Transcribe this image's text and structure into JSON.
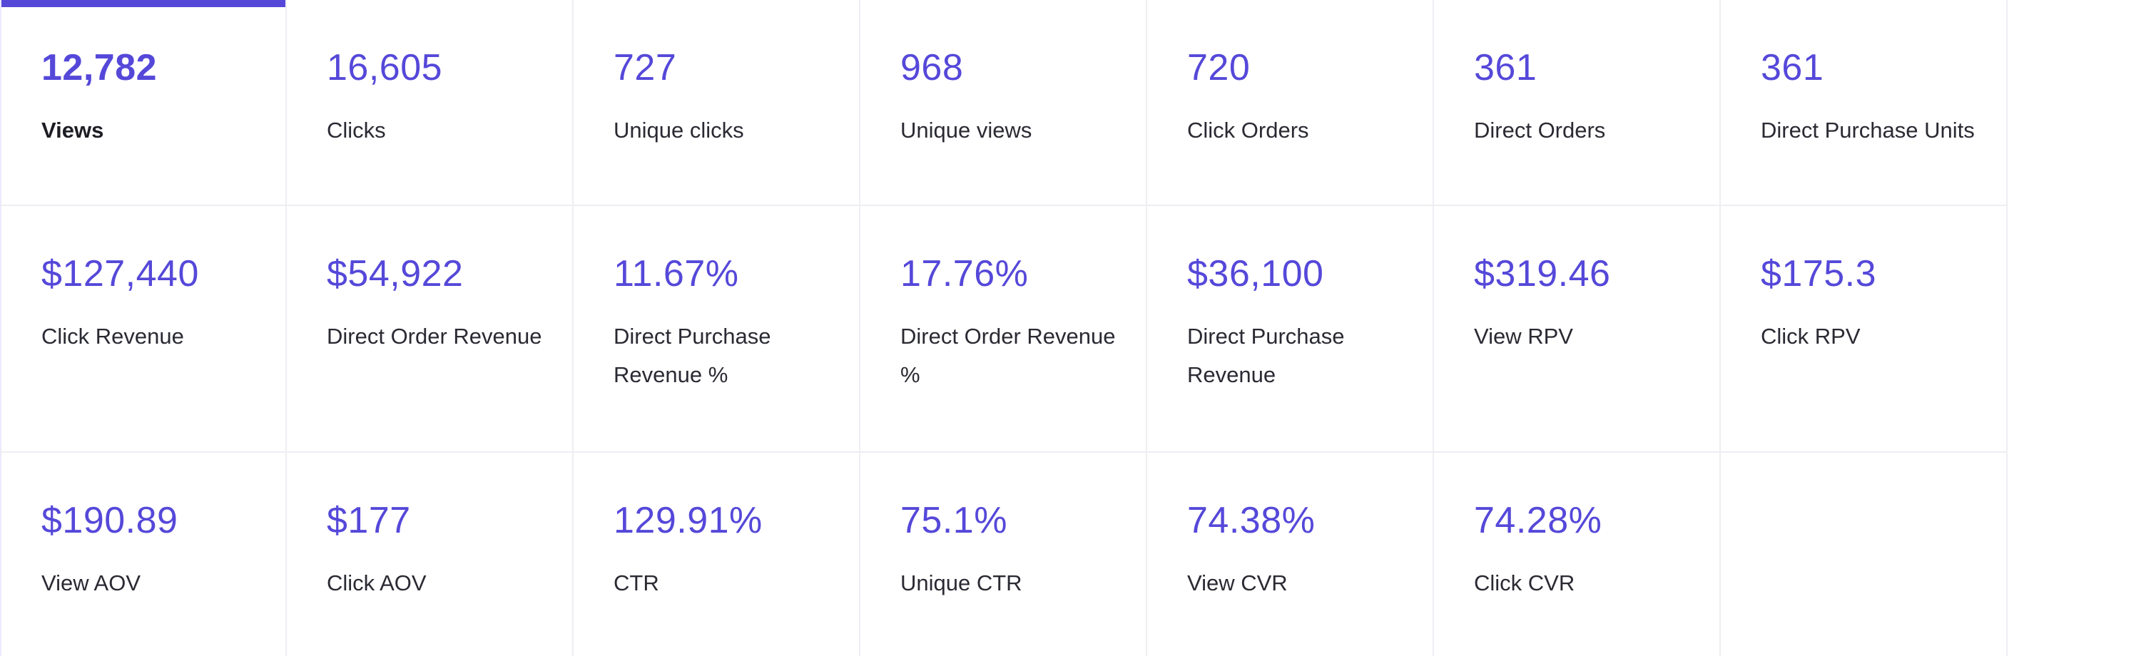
{
  "accent_color": "#5548d9",
  "metrics": [
    {
      "value": "12,782",
      "label": "Views",
      "active": true
    },
    {
      "value": "16,605",
      "label": "Clicks"
    },
    {
      "value": "727",
      "label": "Unique clicks"
    },
    {
      "value": "968",
      "label": "Unique views"
    },
    {
      "value": "720",
      "label": "Click Orders"
    },
    {
      "value": "361",
      "label": "Direct Orders"
    },
    {
      "value": "361",
      "label": "Direct Purchase Units"
    },
    {
      "value": "$127,440",
      "label": "Click Revenue"
    },
    {
      "value": "$54,922",
      "label": "Direct Order Revenue"
    },
    {
      "value": "11.67%",
      "label": "Direct Purchase Revenue %"
    },
    {
      "value": "17.76%",
      "label": "Direct Order Revenue %"
    },
    {
      "value": "$36,100",
      "label": "Direct Purchase Revenue"
    },
    {
      "value": "$319.46",
      "label": "View RPV"
    },
    {
      "value": "$175.3",
      "label": "Click RPV"
    },
    {
      "value": "$190.89",
      "label": "View AOV"
    },
    {
      "value": "$177",
      "label": "Click AOV"
    },
    {
      "value": "129.91%",
      "label": "CTR"
    },
    {
      "value": "75.1%",
      "label": "Unique CTR"
    },
    {
      "value": "74.38%",
      "label": "View CVR"
    },
    {
      "value": "74.28%",
      "label": "Click CVR"
    }
  ]
}
